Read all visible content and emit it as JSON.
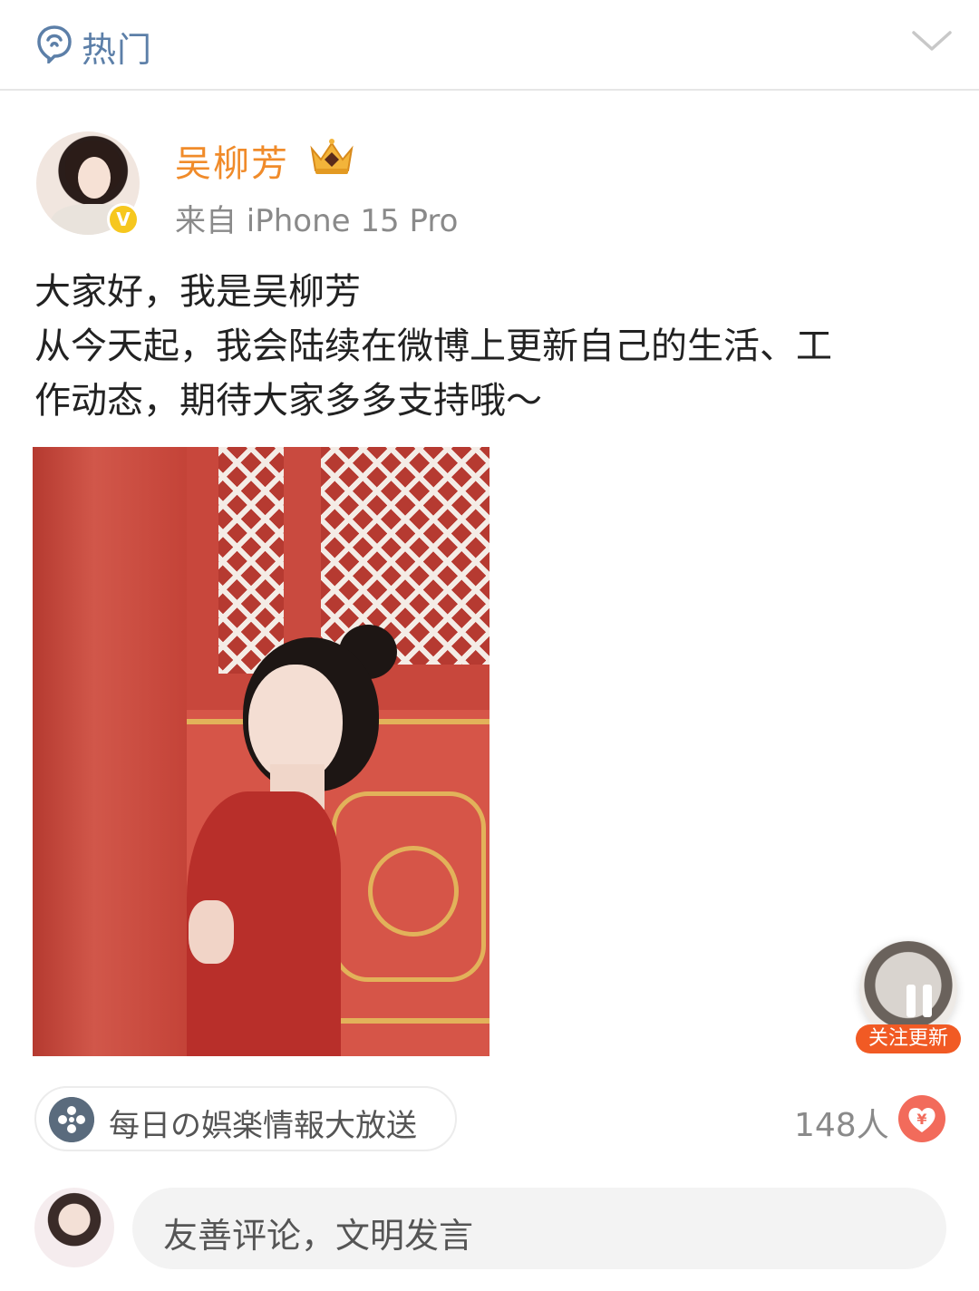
{
  "header": {
    "title": "热门"
  },
  "post": {
    "author_name": "吴柳芳",
    "source": "来自 iPhone 15 Pro",
    "verified_badge": "V",
    "text_lines": [
      "大家好，我是吴柳芳",
      "从今天起，我会陆续在微博上更新自己的生活、工",
      "作动态，期待大家多多支持哦～"
    ]
  },
  "floating": {
    "follow_label": "关注更新"
  },
  "footer": {
    "topic_label": "每日の娯楽情報大放送",
    "reward_count": "148人",
    "reward_symbol": "¥"
  },
  "comment": {
    "placeholder": "友善评论，文明发言"
  },
  "colors": {
    "accent_orange": "#f08b2a",
    "header_blue": "#5c7fa8",
    "follow_red": "#f15a24",
    "verified_gold": "#f6c71e"
  },
  "icons": [
    "hot-topic-icon",
    "chevron-down-icon",
    "crown-icon",
    "verified-icon",
    "pause-icon",
    "topic-icon",
    "reward-icon"
  ]
}
